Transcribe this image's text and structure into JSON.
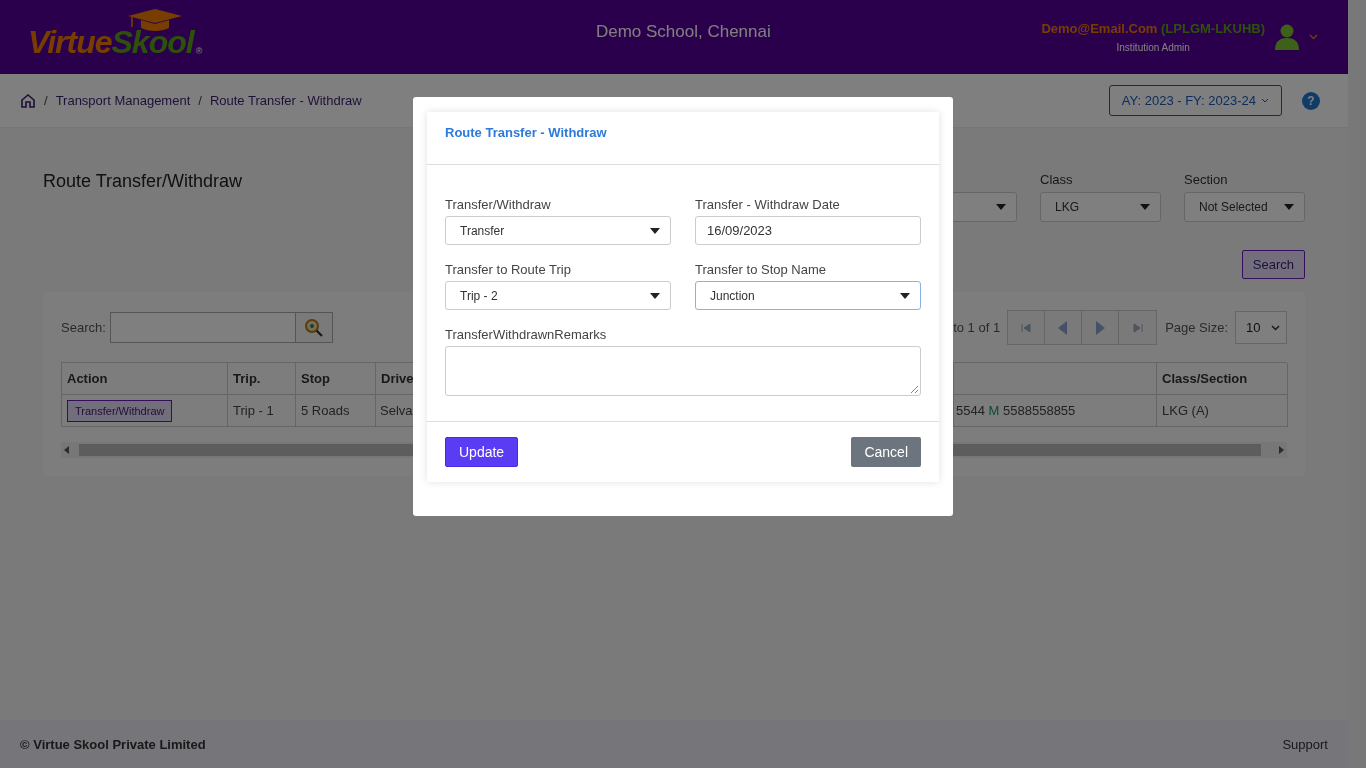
{
  "header": {
    "logo": {
      "first": "Virtue",
      "second": "Skool",
      "mark": "®"
    },
    "school": "Demo School, Chennai",
    "user": {
      "email": "Demo@Email.Com",
      "code": "(LPLGM-LKUHB)",
      "role": "Institution Admin"
    }
  },
  "breadcrumb": {
    "items": [
      {
        "label": "Transport Management"
      },
      {
        "label": "Route Transfer - Withdraw"
      }
    ],
    "separator": "/",
    "year": "AY: 2023 - FY: 2023-24",
    "help": "?"
  },
  "page": {
    "title": "Route Transfer/Withdraw",
    "filters": [
      {
        "kind": "hidden"
      },
      {
        "kind": "select",
        "label": "Class",
        "value": "LKG"
      },
      {
        "kind": "select",
        "label": "Section",
        "value": "Not Selected"
      }
    ],
    "search_button": "Search"
  },
  "grid": {
    "search_label": "Search:",
    "pagination": "to 1 of 1",
    "page_size_label": "Page Size:",
    "page_size": "10",
    "columns": [
      "Action",
      "Trip.",
      "Stop",
      "Drive",
      "Class/Section"
    ],
    "rows": [
      {
        "action": "Transfer/Withdraw",
        "trip": "Trip - 1",
        "stop": "5 Roads",
        "driver": "Selva",
        "phone_1": "5544",
        "phone_tag": "M",
        "phone_2": "5588558855",
        "class_section": "LKG (A)"
      }
    ]
  },
  "modal": {
    "title": "Route Transfer - Withdraw",
    "fields": [
      {
        "kind": "select",
        "label": "Transfer/Withdraw",
        "value": "Transfer",
        "focused": false
      },
      {
        "kind": "input",
        "label": "Transfer - Withdraw Date",
        "value": "16/09/2023",
        "focused": false
      },
      {
        "kind": "select",
        "label": "Transfer to Route Trip",
        "value": "Trip - 2",
        "focused": false
      },
      {
        "kind": "select",
        "label": "Transfer to Stop Name",
        "value": "Junction",
        "focused": true
      },
      {
        "kind": "textarea",
        "label": "TransferWithdrawnRemarks",
        "focused": false
      }
    ],
    "primary": "Update",
    "secondary": "Cancel"
  },
  "footer": {
    "copyright": "© Virtue Skool Private Limited",
    "support": "Support"
  }
}
